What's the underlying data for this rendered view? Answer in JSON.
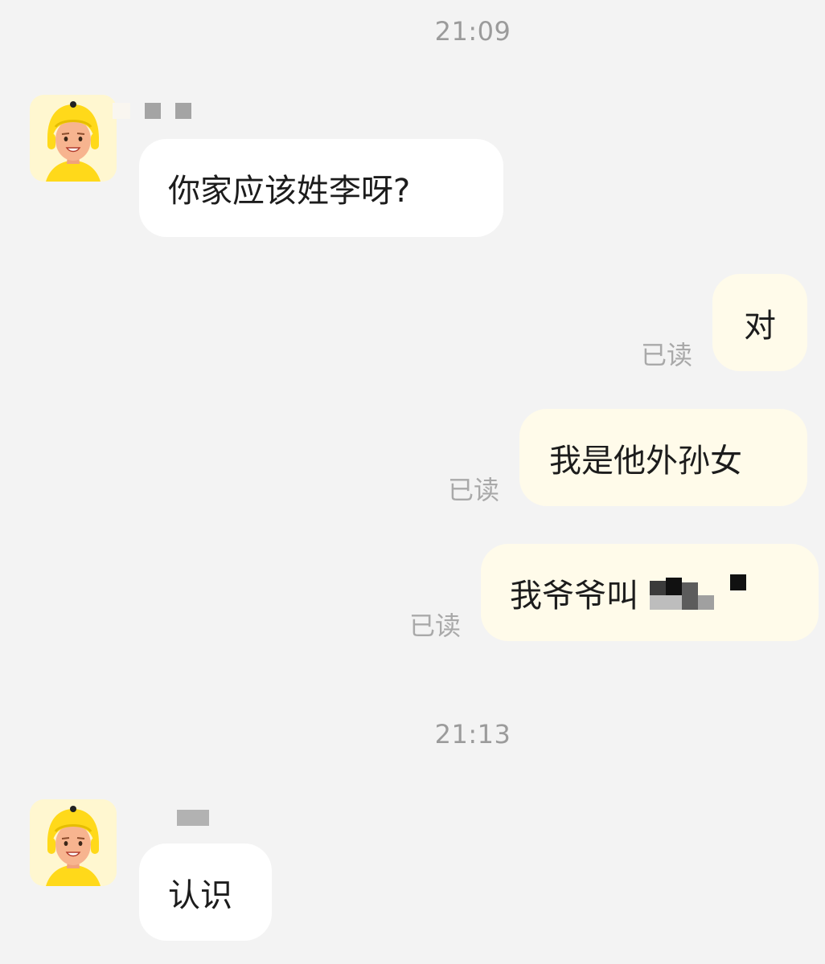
{
  "conversation": {
    "timestamps": [
      "21:09",
      "21:13"
    ],
    "messages": [
      {
        "direction": "incoming",
        "text": "你家应该姓李呀?"
      },
      {
        "direction": "outgoing",
        "text": "对",
        "status": "已读"
      },
      {
        "direction": "outgoing",
        "text": "我是他外孙女",
        "status": "已读"
      },
      {
        "direction": "outgoing",
        "text": "我爷爷叫",
        "status": "已读",
        "redacted_suffix": true
      },
      {
        "direction": "incoming",
        "text": "认识"
      }
    ]
  },
  "colors": {
    "background": "#f3f3f3",
    "incoming_bubble": "#ffffff",
    "outgoing_bubble": "#fffbea",
    "avatar_helmet": "#ffd91a",
    "timestamp_text": "#9b9b9b",
    "read_text": "#a9a9a9"
  },
  "icons": {
    "contact_avatar": "courier-avatar-icon",
    "name_mask": "redacted-name-icon",
    "text_mask": "mosaic-redaction-icon"
  }
}
